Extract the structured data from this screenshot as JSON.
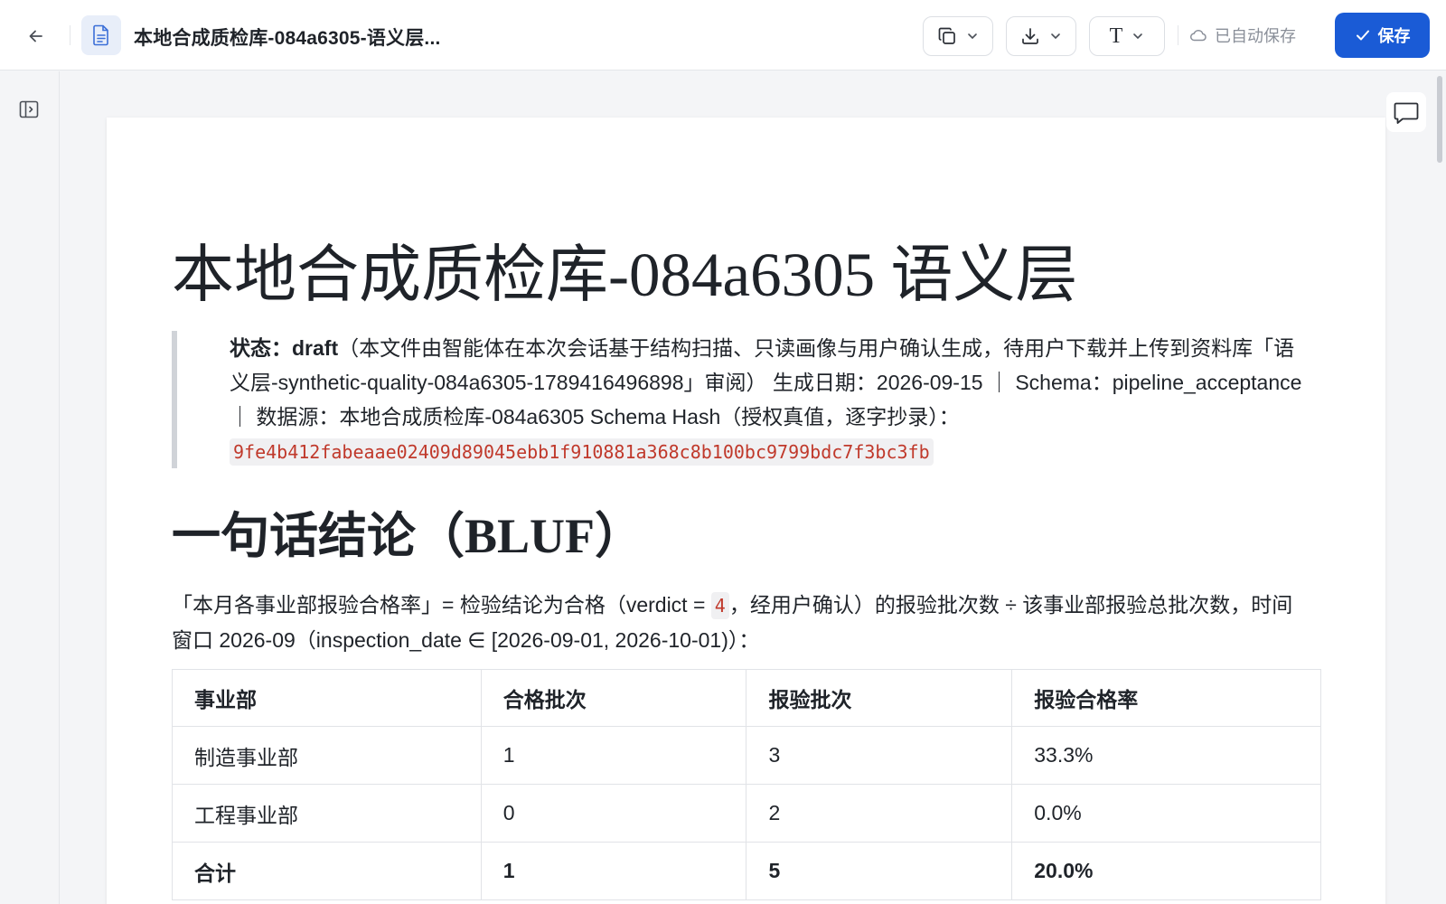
{
  "header": {
    "doc_title": "本地合成质检库-084a6305-语义层...",
    "autosave_label": "已自动保存",
    "save_label": "保存",
    "font_button_glyph": "T"
  },
  "icons": {
    "back": "arrow-left-icon",
    "doc": "document-icon",
    "copy": "copy-icon",
    "download": "download-icon",
    "chevron": "chevron-down-icon",
    "cloud": "cloud-icon",
    "check": "check-icon",
    "panel": "sidebar-toggle-icon",
    "comment": "comment-icon"
  },
  "colors": {
    "primary": "#1a5bd6",
    "code_text": "#c0392b",
    "quote_bar": "#d0d3d8"
  },
  "doc": {
    "title": "本地合成质检库-084a6305 语义层",
    "quote": {
      "status_label": "状态：",
      "status_value": "draft",
      "text_1": "（本文件由智能体在本次会话基于结构扫描、只读画像与用户确认生成，待用户下载并上传到资料库「语义层-synthetic-quality-084a6305-1789416496898」审阅） 生成日期：2026-09-15 ｜ Schema：pipeline_acceptance ｜ 数据源：本地合成质检库-084a6305 Schema Hash（授权真值，逐字抄录）：",
      "hash": "9fe4b412fabeaae02409d89045ebb1f910881a368c8b100bc9799bdc7f3bc3fb"
    },
    "bluf_heading": "一句话结论（BLUF）",
    "bluf": {
      "text_before": "「本月各事业部报验合格率」= 检验结论为合格（verdict = ",
      "verdict_code": "4",
      "text_after": "，经用户确认）的报验批次数 ÷ 该事业部报验总批次数，时间窗口 2026-09（inspection_date ∈ [2026-09-01, 2026-10-01)）："
    },
    "table": {
      "headers": [
        "事业部",
        "合格批次",
        "报验批次",
        "报验合格率"
      ],
      "rows": [
        [
          "制造事业部",
          "1",
          "3",
          "33.3%"
        ],
        [
          "工程事业部",
          "0",
          "2",
          "0.0%"
        ]
      ],
      "total": [
        "合计",
        "1",
        "5",
        "20.0%"
      ]
    }
  }
}
